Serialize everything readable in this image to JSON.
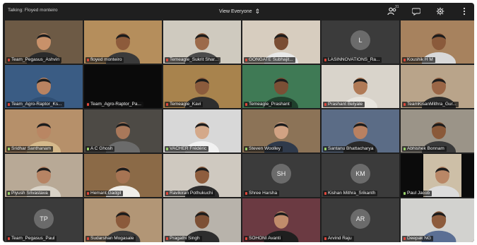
{
  "topbar": {
    "talking": "Talking: Floyed monteiro",
    "view": "View Everyone",
    "participants_count": "31"
  },
  "tiles": [
    {
      "name": "Team_Pegasus_Ashvin",
      "type": "video",
      "bg": "#6d5a45",
      "skin": "#c8916a",
      "shirt": "#2b2b2b",
      "mic": "off"
    },
    {
      "name": "floyed monteiro",
      "type": "video",
      "bg": "#b58e5c",
      "skin": "#8d5b3b",
      "shirt": "#3a3a3a",
      "mic": "off"
    },
    {
      "name": "Temeagle_Sukrit Shar...",
      "type": "video",
      "bg": "#cfcabf",
      "skin": "#9c6a4a",
      "shirt": "#4b4b4b",
      "mic": "off"
    },
    {
      "name": "GONGATE Subhajit...",
      "type": "video",
      "bg": "#d7cdbf",
      "skin": "#7a4d33",
      "shirt": "#e8e8e8",
      "mic": "off"
    },
    {
      "name": "LASINNOVATIONS_Ra...",
      "type": "avatar",
      "initials": "L",
      "mic": "off"
    },
    {
      "name": "Koushik H M",
      "type": "video",
      "bg": "#a7825e",
      "skin": "#8a5a3b",
      "shirt": "#d9d9d9",
      "mic": "off"
    },
    {
      "name": "Team_Agro-Raptor_Ks...",
      "type": "video",
      "bg": "#3a5c84",
      "skin": "#b98361",
      "shirt": "#2f4e73",
      "mic": "off"
    },
    {
      "name": "Team_Agro-Raptor_Pa...",
      "type": "dark",
      "mic": "off"
    },
    {
      "name": "Temeagle_Kavi",
      "type": "video",
      "bg": "#a8834d",
      "skin": "#8b5b3c",
      "shirt": "#2e2e2e",
      "mic": "off"
    },
    {
      "name": "Temeagle_Prashant",
      "type": "video",
      "bg": "#3f7a55",
      "skin": "#7a4f35",
      "shirt": "#1f3f2c",
      "mic": "off"
    },
    {
      "name": "Prashant Belyale",
      "type": "video",
      "bg": "#d9d4cb",
      "skin": "#b07a56",
      "shirt": "#e8e5de",
      "mic": "off"
    },
    {
      "name": "TeamKisanMithra_Gur...",
      "type": "video",
      "bg": "#b9a48a",
      "skin": "#9a6646",
      "shirt": "#2b2b2b",
      "mic": "off"
    },
    {
      "name": "Sridhar Santhanam",
      "type": "video",
      "bg": "#b6906a",
      "skin": "#b98663",
      "shirt": "#d5b98b",
      "mic": "on"
    },
    {
      "name": "A C Ghosh",
      "type": "video",
      "bg": "#4d4a45",
      "skin": "#a9785a",
      "shirt": "#6b6b6b",
      "mic": "on"
    },
    {
      "name": "VACHER Frédéric",
      "type": "video",
      "bg": "#d8d8d8",
      "skin": "#d4a98a",
      "shirt": "#f1f1f1",
      "mic": "on"
    },
    {
      "name": "Steven Woolley",
      "type": "video",
      "bg": "#8c7357",
      "skin": "#d1a283",
      "shirt": "#2f3a4b",
      "mic": "on"
    },
    {
      "name": "Santanu Bhattacharya",
      "type": "video",
      "bg": "#5b6c86",
      "skin": "#b98161",
      "shirt": "#2a2a2a",
      "mic": "on"
    },
    {
      "name": "Abhishek Bonnam",
      "type": "video",
      "bg": "#9b9488",
      "skin": "#8a5939",
      "shirt": "#3a3a3a",
      "mic": "on"
    },
    {
      "name": "Piyush Srivastava",
      "type": "video",
      "bg": "#b8a996",
      "skin": "#b78464",
      "shirt": "#d9d3c8",
      "mic": "on"
    },
    {
      "name": "Hemant Gadgil",
      "type": "video",
      "bg": "#8b6a47",
      "skin": "#a67453",
      "shirt": "#f0eee9",
      "mic": "off"
    },
    {
      "name": "Ravikiran Pothukuchi",
      "type": "video",
      "bg": "#cfc9c0",
      "skin": "#8e5d3d",
      "shirt": "#2b2b2b",
      "mic": "off"
    },
    {
      "name": "Shree Harsha",
      "type": "avatar",
      "initials": "SH",
      "mic": "off"
    },
    {
      "name": "Kishan Mithra_Srikanth",
      "type": "avatar",
      "initials": "KM",
      "mic": "off"
    },
    {
      "name": "Paul Jacob",
      "type": "video",
      "bg": "#0b0b0b",
      "inset": "#cdbfa7",
      "skin": "#b98766",
      "shirt": "#dcdcdc",
      "mic": "on"
    },
    {
      "name": "Team_Pegasus_Paul",
      "type": "avatar",
      "initials": "TP",
      "mic": "off"
    },
    {
      "name": "Sudarshan Mogasale",
      "type": "video",
      "bg": "#b29676",
      "skin": "#8b5a3b",
      "shirt": "#3a3a3a",
      "mic": "off"
    },
    {
      "name": "Pragathi Singh",
      "type": "video",
      "bg": "#b8b3ab",
      "skin": "#7d5035",
      "shirt": "#2d2d2d",
      "mic": "off"
    },
    {
      "name": "SOHONI Avanti",
      "type": "video",
      "bg": "#6b3a42",
      "skin": "#c08c6b",
      "shirt": "#1f1f1f",
      "mic": "off"
    },
    {
      "name": "Arvind Raju",
      "type": "avatar",
      "initials": "AR",
      "mic": "off"
    },
    {
      "name": "Deepak NG",
      "type": "video",
      "bg": "#d2d2cf",
      "skin": "#8d5c3d",
      "shirt": "#5b6f94",
      "mic": "off"
    }
  ],
  "colors": {
    "window_bg": "#1f1f1f",
    "mic_off": "#e0473b",
    "mic_on": "#9ad36a"
  },
  "icons": {
    "participants": "people-icon",
    "chat": "chat-bubble-icon",
    "settings": "gear-icon",
    "more": "more-vertical-icon",
    "view_switch": "swap-icon"
  }
}
